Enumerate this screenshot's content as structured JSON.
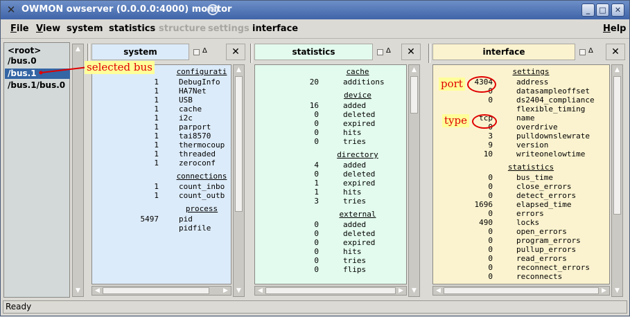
{
  "window": {
    "title": "OWMON owserver (0.0.0.0:4000) monitor",
    "buttons": {
      "minimize": "_",
      "maximize": "□",
      "close": "✕"
    }
  },
  "menubar": {
    "file": "File",
    "view": "View",
    "system": "system",
    "statistics": "statistics",
    "structure": "structure",
    "settings": "settings",
    "interface": "interface",
    "help": "Help"
  },
  "tree": {
    "items": [
      {
        "label": "<root>",
        "selected": false
      },
      {
        "label": "/bus.0",
        "selected": false
      },
      {
        "label": "/bus.1",
        "selected": true
      },
      {
        "label": "/bus.1/bus.0",
        "selected": false
      }
    ]
  },
  "panes": {
    "system": {
      "title": "system",
      "delta": "Δ",
      "close": "✕",
      "sections": [
        {
          "title": "configurati",
          "rows": [
            {
              "value": "1",
              "label": "DebugInfo"
            },
            {
              "value": "1",
              "label": "HA7Net"
            },
            {
              "value": "1",
              "label": "USB"
            },
            {
              "value": "1",
              "label": "cache"
            },
            {
              "value": "1",
              "label": "i2c"
            },
            {
              "value": "1",
              "label": "parport"
            },
            {
              "value": "1",
              "label": "tai8570"
            },
            {
              "value": "1",
              "label": "thermocoup"
            },
            {
              "value": "1",
              "label": "threaded"
            },
            {
              "value": "1",
              "label": "zeroconf"
            }
          ]
        },
        {
          "title": "connections",
          "rows": [
            {
              "value": "1",
              "label": "count_inbo"
            },
            {
              "value": "1",
              "label": "count_outb"
            }
          ]
        },
        {
          "title": "process",
          "rows": [
            {
              "value": "5497",
              "label": "pid"
            },
            {
              "value": "",
              "label": "pidfile"
            }
          ]
        }
      ]
    },
    "statistics": {
      "title": "statistics",
      "delta": "Δ",
      "close": "✕",
      "sections": [
        {
          "title": "cache",
          "rows": [
            {
              "value": "20",
              "label": "additions"
            }
          ]
        },
        {
          "title": "device",
          "rows": [
            {
              "value": "16",
              "label": "added"
            },
            {
              "value": "0",
              "label": "deleted"
            },
            {
              "value": "0",
              "label": "expired"
            },
            {
              "value": "0",
              "label": "hits"
            },
            {
              "value": "0",
              "label": "tries"
            }
          ]
        },
        {
          "title": "directory",
          "rows": [
            {
              "value": "4",
              "label": "added"
            },
            {
              "value": "0",
              "label": "deleted"
            },
            {
              "value": "1",
              "label": "expired"
            },
            {
              "value": "1",
              "label": "hits"
            },
            {
              "value": "3",
              "label": "tries"
            }
          ]
        },
        {
          "title": "external",
          "rows": [
            {
              "value": "0",
              "label": "added"
            },
            {
              "value": "0",
              "label": "deleted"
            },
            {
              "value": "0",
              "label": "expired"
            },
            {
              "value": "0",
              "label": "hits"
            },
            {
              "value": "0",
              "label": "tries"
            },
            {
              "value": "0",
              "label": "flips"
            }
          ]
        }
      ]
    },
    "interface": {
      "title": "interface",
      "delta": "Δ",
      "close": "✕",
      "sections": [
        {
          "title": "settings",
          "rows": [
            {
              "value": "4304",
              "label": "address"
            },
            {
              "value": "0",
              "label": "datasampleoffset"
            },
            {
              "value": "0",
              "label": "ds2404_compliance"
            },
            {
              "value": "",
              "label": "flexible_timing"
            },
            {
              "value": "tcp",
              "label": "name"
            },
            {
              "value": "0",
              "label": "overdrive"
            },
            {
              "value": "3",
              "label": "pulldownslewrate"
            },
            {
              "value": "9",
              "label": "version"
            },
            {
              "value": "10",
              "label": "writeonelowtime"
            }
          ]
        },
        {
          "title": "statistics",
          "rows": [
            {
              "value": "0",
              "label": "bus_time"
            },
            {
              "value": "0",
              "label": "close_errors"
            },
            {
              "value": "0",
              "label": "detect_errors"
            },
            {
              "value": "1696",
              "label": "elapsed_time"
            },
            {
              "value": "0",
              "label": "errors"
            },
            {
              "value": "490",
              "label": "locks"
            },
            {
              "value": "0",
              "label": "open_errors"
            },
            {
              "value": "0",
              "label": "program_errors"
            },
            {
              "value": "0",
              "label": "pullup_errors"
            },
            {
              "value": "0",
              "label": "read_errors"
            },
            {
              "value": "0",
              "label": "reconnect_errors"
            },
            {
              "value": "0",
              "label": "reconnects"
            }
          ]
        }
      ]
    }
  },
  "annotations": {
    "selected_bus": "selected bus",
    "port": "port",
    "type": "type"
  },
  "status": {
    "text": "Ready"
  },
  "colors": {
    "system_body": "#dcebf9",
    "statistics_body": "#e3fbee",
    "interface_body": "#fbf3cf",
    "selection": "#3465a4",
    "annotation": "#e00000"
  }
}
